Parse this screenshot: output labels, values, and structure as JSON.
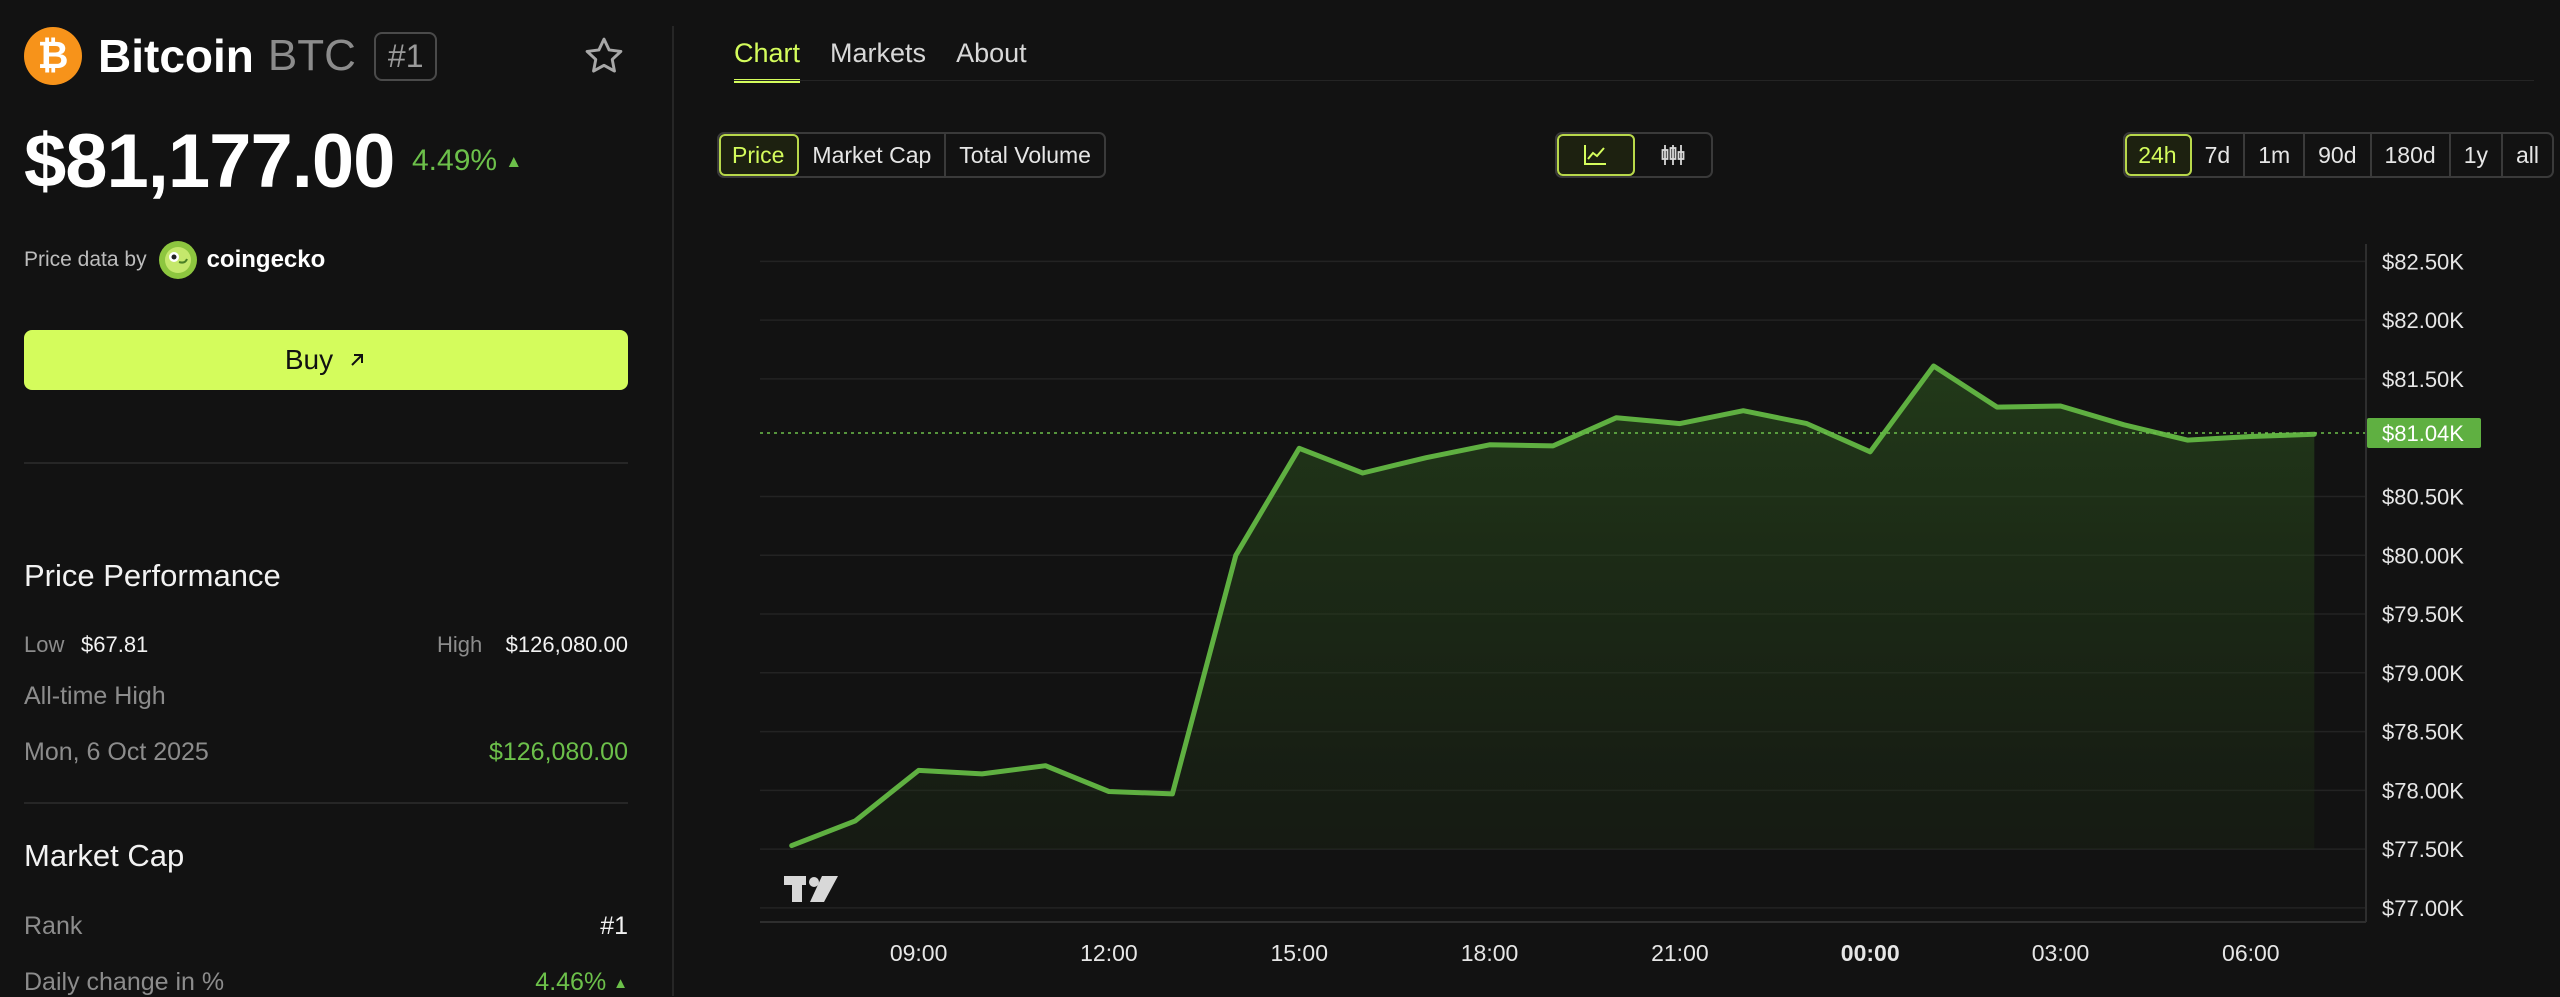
{
  "coin": {
    "name": "Bitcoin",
    "symbol": "BTC",
    "rank": "#1",
    "logo_glyph": "₿",
    "logo_color": "#f7931a"
  },
  "price": {
    "value": "$81,177.00",
    "change": "4.49%",
    "change_arrow": "▲",
    "data_by": "Price data by",
    "provider": "coingecko"
  },
  "actions": {
    "buy_label": "Buy"
  },
  "performance": {
    "title": "Price Performance",
    "low_label": "Low",
    "low_value": "$67.81",
    "high_label": "High",
    "high_value": "$126,080.00",
    "ath_label": "All-time High",
    "ath_date": "Mon, 6 Oct 2025",
    "ath_value": "$126,080.00"
  },
  "market_cap": {
    "title": "Market Cap",
    "rank_label": "Rank",
    "rank_value": "#1",
    "daily_change_label": "Daily change in %",
    "daily_change_value": "4.46%",
    "daily_change_arrow": "▲"
  },
  "tabs": [
    {
      "label": "Chart"
    },
    {
      "label": "Markets"
    },
    {
      "label": "About"
    }
  ],
  "metric_options": [
    {
      "label": "Price"
    },
    {
      "label": "Market Cap"
    },
    {
      "label": "Total Volume"
    }
  ],
  "range_options": [
    {
      "label": "24h"
    },
    {
      "label": "7d"
    },
    {
      "label": "1m"
    },
    {
      "label": "90d"
    },
    {
      "label": "180d"
    },
    {
      "label": "1y"
    },
    {
      "label": "all"
    }
  ],
  "colors": {
    "accent": "#d4fc5c",
    "positive": "#6cc04a",
    "line": "#5fb041",
    "background": "#121212"
  },
  "chart_data": {
    "type": "area",
    "y_ticks": [
      "$82.50K",
      "$82.00K",
      "$81.50K",
      "$81.04K",
      "$80.50K",
      "$80.00K",
      "$79.50K",
      "$79.00K",
      "$78.50K",
      "$78.00K",
      "$77.50K",
      "$77.00K"
    ],
    "x_ticks": [
      "09:00",
      "12:00",
      "15:00",
      "18:00",
      "21:00",
      "00:00",
      "03:00",
      "06:00"
    ],
    "current_label": "$81.04K",
    "current_value": 81040,
    "ylim": [
      77000,
      82500
    ],
    "xlim": [
      6.5,
      31.5
    ],
    "grid": true,
    "x": [
      7,
      8,
      9,
      10,
      11,
      12,
      13,
      14,
      15,
      16,
      17,
      18,
      19,
      20,
      21,
      22,
      23,
      24,
      25,
      26,
      27,
      28,
      29,
      30,
      31
    ],
    "values": [
      77530,
      77740,
      78170,
      78140,
      78210,
      77990,
      77970,
      80000,
      80910,
      80700,
      80830,
      80940,
      80930,
      81170,
      81120,
      81230,
      81120,
      80880,
      81610,
      81260,
      81270,
      81110,
      80980,
      81010,
      81030
    ]
  }
}
